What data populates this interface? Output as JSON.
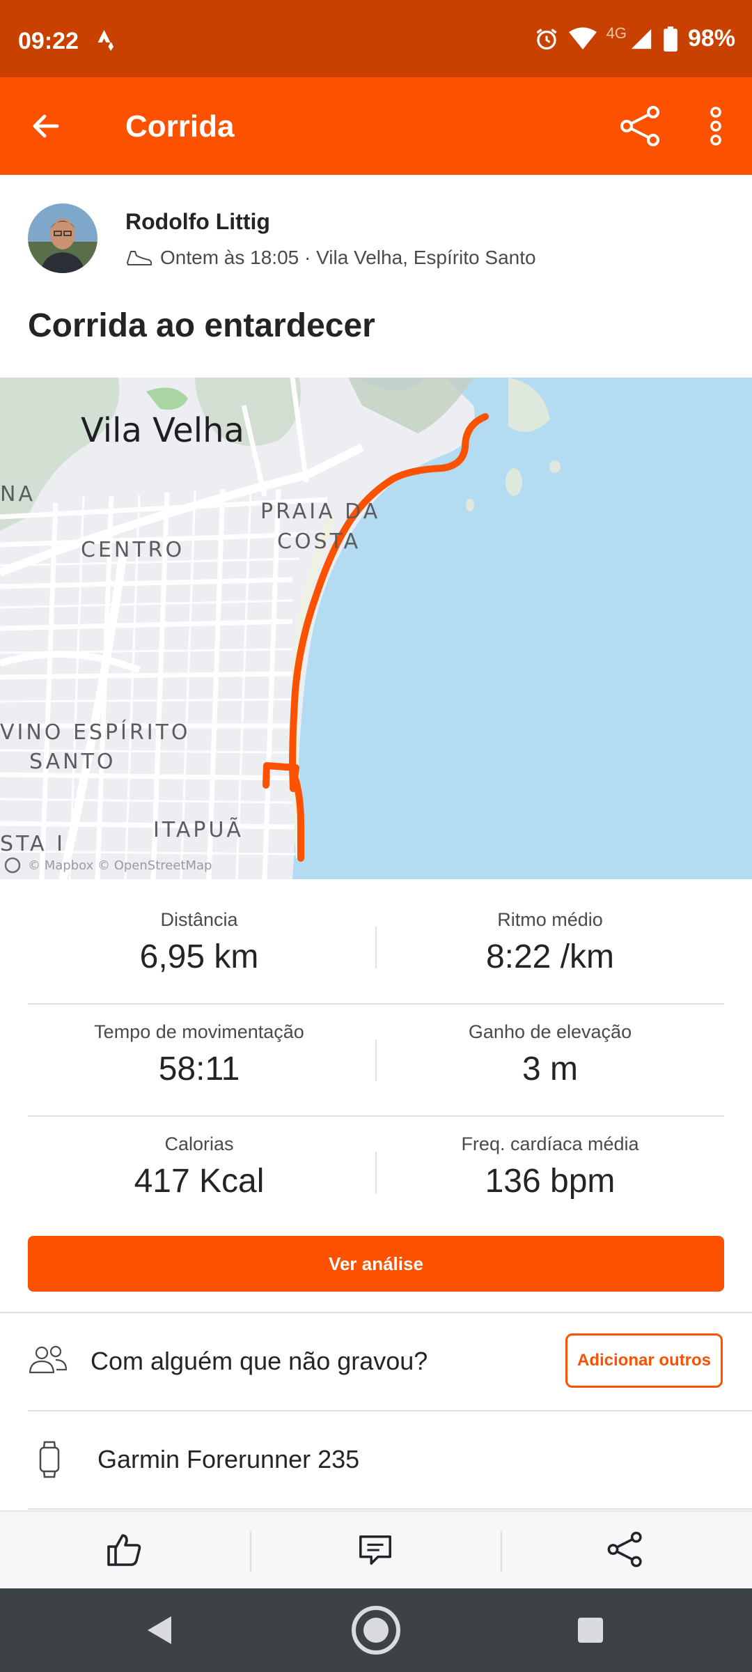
{
  "status_bar": {
    "time": "09:22",
    "network": "4G",
    "battery": "98%"
  },
  "app_bar": {
    "title": "Corrida",
    "back_icon": "arrow-left-icon",
    "share_icon": "share-icon",
    "more_icon": "more-vertical-icon"
  },
  "activity": {
    "athlete_name": "Rodolfo Littig",
    "meta": "Ontem às 18:05 · Vila Velha, Espírito Santo",
    "title": "Corrida ao entardecer"
  },
  "map": {
    "labels": {
      "city": "Vila Velha",
      "praia_1": "PRAIA DA",
      "praia_2": "COSTA",
      "centro": "CENTRO",
      "divino_1": "VINO ESPÍRITO",
      "divino_2": "SANTO",
      "itapua": "ITAPUÃ",
      "left_edge_1": "NA",
      "left_edge_2": "STA I",
      "attribution": "© Mapbox © OpenStreetMap"
    },
    "route_color": "#fc5200"
  },
  "stats": [
    {
      "label": "Distância",
      "value": "6,95 km"
    },
    {
      "label": "Ritmo médio",
      "value": "8:22 /km"
    },
    {
      "label": "Tempo de movimentação",
      "value": "58:11"
    },
    {
      "label": "Ganho de elevação",
      "value": "3 m"
    },
    {
      "label": "Calorias",
      "value": "417 Kcal"
    },
    {
      "label": "Freq. cardíaca média",
      "value": "136 bpm"
    }
  ],
  "actions": {
    "analysis_button": "Ver análise",
    "with_someone": "Com alguém que não gravou?",
    "add_others_button": "Adicionar outros",
    "device": "Garmin Forerunner 235"
  },
  "bottom_bar": {
    "kudos_icon": "thumbs-up-icon",
    "comment_icon": "comment-icon",
    "share_icon": "share-icon"
  },
  "colors": {
    "brand": "#fc5200",
    "status_bar": "#c94100",
    "nav_bar": "#3d4246",
    "water": "#b3dcf2"
  }
}
